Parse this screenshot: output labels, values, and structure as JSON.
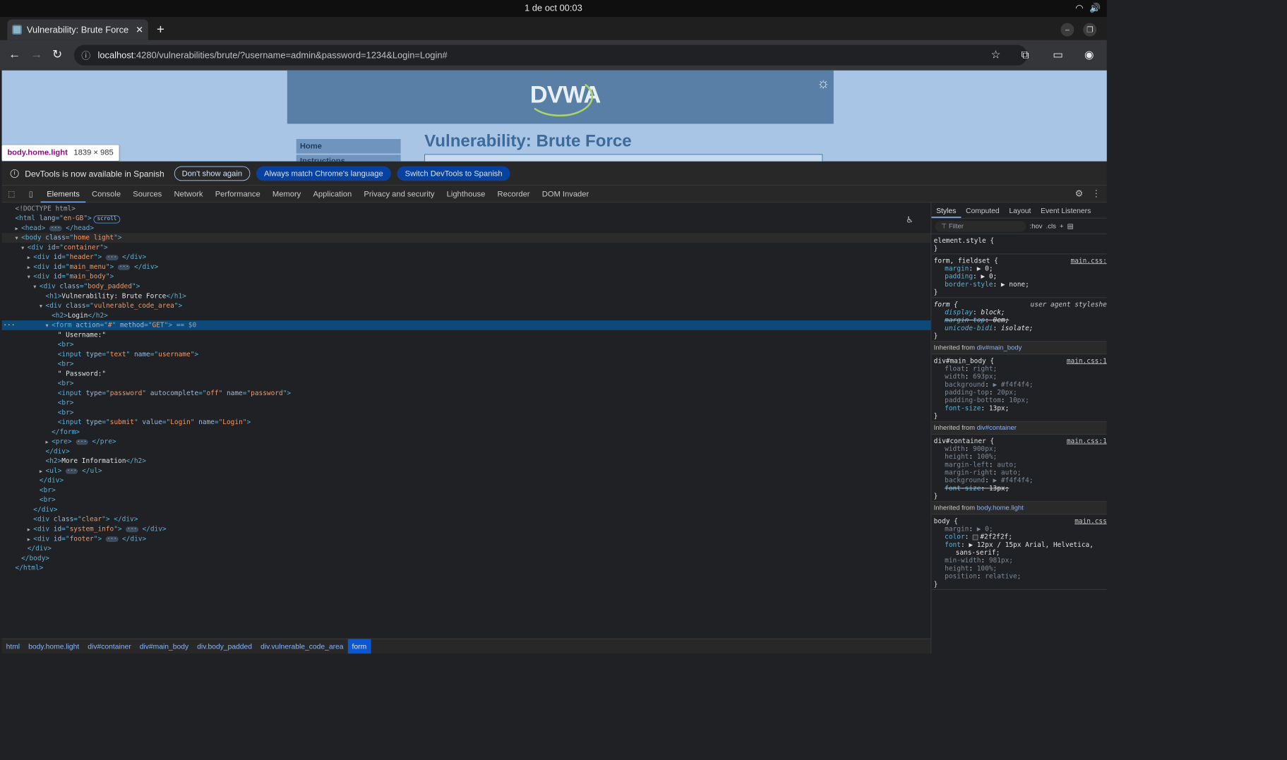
{
  "os_bar": {
    "datetime": "1 de oct  00:03"
  },
  "browser": {
    "tab_title": "Vulnerability: Brute Force",
    "url_host": "localhost",
    "url_rest": ":4280/vulnerabilities/brute/?username=admin&password=1234&Login=Login#"
  },
  "page": {
    "logo": "DVWA",
    "menu_item_1": "Home",
    "menu_item_2": "Instructions",
    "title": "Vulnerability: Brute Force"
  },
  "inspect_tooltip": {
    "selector": "body.home.light",
    "size": "1839 × 985"
  },
  "infobar": {
    "message": "DevTools is now available in Spanish",
    "btn_dont_show": "Don't show again",
    "btn_match": "Always match Chrome's language",
    "btn_switch": "Switch DevTools to Spanish"
  },
  "devtools_tabs": [
    "Elements",
    "Console",
    "Sources",
    "Network",
    "Performance",
    "Memory",
    "Application",
    "Privacy and security",
    "Lighthouse",
    "Recorder",
    "DOM Invader"
  ],
  "dom_lines": [
    {
      "indent": 0,
      "tri": "",
      "html": "<span class='cm'>&lt;!DOCTYPE html&gt;</span>"
    },
    {
      "indent": 0,
      "tri": "",
      "html": "<span class='t'>&lt;html </span><span class='an'>lang</span><span class='t'>=\"</span><span class='av'>en-GB</span><span class='t'>\"&gt;</span><span class='badge'>scroll</span>"
    },
    {
      "indent": 1,
      "tri": "▶",
      "html": "<span class='t'>&lt;head&gt;</span> <span class='ell'>···</span> <span class='t'>&lt;/head&gt;</span>"
    },
    {
      "indent": 1,
      "tri": "▼",
      "html": "<span class='t'>&lt;body </span><span class='an'>class</span><span class='t'>=\"</span><span class='av'>home light</span><span class='t'>\"&gt;</span>",
      "cls": "hov"
    },
    {
      "indent": 2,
      "tri": "▼",
      "html": "<span class='t'>&lt;div </span><span class='an'>id</span><span class='t'>=\"</span><span class='av'>container</span><span class='t'>\"&gt;</span>"
    },
    {
      "indent": 3,
      "tri": "▶",
      "html": "<span class='t'>&lt;div </span><span class='an'>id</span><span class='t'>=\"</span><span class='av'>header</span><span class='t'>\"&gt;</span> <span class='ell'>···</span> <span class='t'>&lt;/div&gt;</span>"
    },
    {
      "indent": 3,
      "tri": "▶",
      "html": "<span class='t'>&lt;div </span><span class='an'>id</span><span class='t'>=\"</span><span class='av'>main_menu</span><span class='t'>\"&gt;</span> <span class='ell'>···</span> <span class='t'>&lt;/div&gt;</span>"
    },
    {
      "indent": 3,
      "tri": "▼",
      "html": "<span class='t'>&lt;div </span><span class='an'>id</span><span class='t'>=\"</span><span class='av'>main_body</span><span class='t'>\"&gt;</span>"
    },
    {
      "indent": 4,
      "tri": "▼",
      "html": "<span class='t'>&lt;div </span><span class='an'>class</span><span class='t'>=\"</span><span class='av'>body_padded</span><span class='t'>\"&gt;</span>"
    },
    {
      "indent": 5,
      "tri": "",
      "html": "<span class='t'>&lt;h1&gt;</span><span class='tx'>Vulnerability: Brute Force</span><span class='t'>&lt;/h1&gt;</span>"
    },
    {
      "indent": 5,
      "tri": "▼",
      "html": "<span class='t'>&lt;div </span><span class='an'>class</span><span class='t'>=\"</span><span class='av'>vulnerable_code_area</span><span class='t'>\"&gt;</span>"
    },
    {
      "indent": 6,
      "tri": "",
      "html": "<span class='t'>&lt;h2&gt;</span><span class='tx'>Login</span><span class='t'>&lt;/h2&gt;</span>"
    },
    {
      "indent": 6,
      "tri": "▼",
      "html": "<span class='t'>&lt;form </span><span class='an'>action</span><span class='t'>=\"</span><span class='av'>#</span><span class='t'>\" </span><span class='an'>method</span><span class='t'>=\"</span><span class='av'>GET</span><span class='t'>\"&gt;</span> <span class='cm'>== $0</span>",
      "cls": "sel"
    },
    {
      "indent": 7,
      "tri": "",
      "html": "<span class='tx'>\" Username:\"</span>"
    },
    {
      "indent": 7,
      "tri": "",
      "html": "<span class='t'>&lt;br&gt;</span>"
    },
    {
      "indent": 7,
      "tri": "",
      "html": "<span class='t'>&lt;input </span><span class='an'>type</span><span class='t'>=\"</span><span class='av'>text</span><span class='t'>\" </span><span class='an'>name</span><span class='t'>=\"</span><span class='av'>username</span><span class='t'>\"&gt;</span>"
    },
    {
      "indent": 7,
      "tri": "",
      "html": "<span class='t'>&lt;br&gt;</span>"
    },
    {
      "indent": 7,
      "tri": "",
      "html": "<span class='tx'>\" Password:\"</span>"
    },
    {
      "indent": 7,
      "tri": "",
      "html": "<span class='t'>&lt;br&gt;</span>"
    },
    {
      "indent": 7,
      "tri": "",
      "html": "<span class='t'>&lt;input </span><span class='an'>type</span><span class='t'>=\"</span><span class='av'>password</span><span class='t'>\" </span><span class='an'>autocomplete</span><span class='t'>=\"</span><span class='av'>off</span><span class='t'>\" </span><span class='an'>name</span><span class='t'>=\"</span><span class='av'>password</span><span class='t'>\"&gt;</span>"
    },
    {
      "indent": 7,
      "tri": "",
      "html": "<span class='t'>&lt;br&gt;</span>"
    },
    {
      "indent": 7,
      "tri": "",
      "html": "<span class='t'>&lt;br&gt;</span>"
    },
    {
      "indent": 7,
      "tri": "",
      "html": "<span class='t'>&lt;input </span><span class='an'>type</span><span class='t'>=\"</span><span class='av'>submit</span><span class='t'>\" </span><span class='an'>value</span><span class='t'>=\"</span><span class='av'>Login</span><span class='t'>\" </span><span class='an'>name</span><span class='t'>=\"</span><span class='av'>Login</span><span class='t'>\"&gt;</span>"
    },
    {
      "indent": 6,
      "tri": "",
      "html": "<span class='t'>&lt;/form&gt;</span>"
    },
    {
      "indent": 6,
      "tri": "▶",
      "html": "<span class='t'>&lt;pre&gt;</span> <span class='ell'>···</span> <span class='t'>&lt;/pre&gt;</span>"
    },
    {
      "indent": 5,
      "tri": "",
      "html": "<span class='t'>&lt;/div&gt;</span>"
    },
    {
      "indent": 5,
      "tri": "",
      "html": "<span class='t'>&lt;h2&gt;</span><span class='tx'>More Information</span><span class='t'>&lt;/h2&gt;</span>"
    },
    {
      "indent": 5,
      "tri": "▶",
      "html": "<span class='t'>&lt;ul&gt;</span> <span class='ell'>···</span> <span class='t'>&lt;/ul&gt;</span>"
    },
    {
      "indent": 4,
      "tri": "",
      "html": "<span class='t'>&lt;/div&gt;</span>"
    },
    {
      "indent": 4,
      "tri": "",
      "html": "<span class='t'>&lt;br&gt;</span>"
    },
    {
      "indent": 4,
      "tri": "",
      "html": "<span class='t'>&lt;br&gt;</span>"
    },
    {
      "indent": 3,
      "tri": "",
      "html": "<span class='t'>&lt;/div&gt;</span>"
    },
    {
      "indent": 3,
      "tri": "",
      "html": "<span class='t'>&lt;div </span><span class='an'>class</span><span class='t'>=\"</span><span class='av'>clear</span><span class='t'>\"&gt; &lt;/div&gt;</span>"
    },
    {
      "indent": 3,
      "tri": "▶",
      "html": "<span class='t'>&lt;div </span><span class='an'>id</span><span class='t'>=\"</span><span class='av'>system_info</span><span class='t'>\"&gt;</span> <span class='ell'>···</span> <span class='t'>&lt;/div&gt;</span>"
    },
    {
      "indent": 3,
      "tri": "▶",
      "html": "<span class='t'>&lt;div </span><span class='an'>id</span><span class='t'>=\"</span><span class='av'>footer</span><span class='t'>\"&gt;</span> <span class='ell'>···</span> <span class='t'>&lt;/div&gt;</span>"
    },
    {
      "indent": 2,
      "tri": "",
      "html": "<span class='t'>&lt;/div&gt;</span>"
    },
    {
      "indent": 1,
      "tri": "",
      "html": "<span class='t'>&lt;/body&gt;</span>"
    },
    {
      "indent": 0,
      "tri": "",
      "html": "<span class='t'>&lt;/html&gt;</span>"
    }
  ],
  "breadcrumbs": [
    "html",
    "body.home.light",
    "div#container",
    "div#main_body",
    "div.body_padded",
    "div.vulnerable_code_area",
    "form"
  ],
  "styles_tabs": [
    "Styles",
    "Computed",
    "Layout",
    "Event Listeners"
  ],
  "styles_filter": {
    "placeholder": "Filter",
    "hov": ":hov",
    "cls": ".cls"
  },
  "styles": {
    "element_style": "element.style {",
    "r1_sel": "form, fieldset {",
    "r1_src": "main.css:",
    "r1_p1n": "margin",
    "r1_p1v": "▶ 0;",
    "r1_p2n": "padding",
    "r1_p2v": "▶ 0;",
    "r1_p3n": "border-style",
    "r1_p3v": "▶ none;",
    "r2_sel": "form {",
    "r2_src": "user agent styleshe",
    "r2_p1n": "display",
    "r2_p1v": "block;",
    "r2_p2n": "margin-top",
    "r2_p2v": "0em;",
    "r2_p3n": "unicode-bidi",
    "r2_p3v": "isolate;",
    "inh1": "Inherited from ",
    "inh1_sel": "div#main_body",
    "r3_sel": "div#main_body {",
    "r3_src": "main.css:1",
    "r3": [
      [
        "float",
        "right;"
      ],
      [
        "width",
        "693px;"
      ],
      [
        "background",
        "▶ #f4f4f4;"
      ],
      [
        "padding-top",
        "20px;"
      ],
      [
        "padding-bottom",
        "10px;"
      ]
    ],
    "r3_fsn": "font-size",
    "r3_fsv": "13px;",
    "inh2": "Inherited from ",
    "inh2_sel": "div#container",
    "r4_sel": "div#container {",
    "r4_src": "main.css:1",
    "r4": [
      [
        "width",
        "900px;"
      ],
      [
        "height",
        "100%;"
      ],
      [
        "margin-left",
        "auto;"
      ],
      [
        "margin-right",
        "auto;"
      ],
      [
        "background",
        "▶ #f4f4f4;"
      ]
    ],
    "r4_fsn": "font-size",
    "r4_fsv": "13px;",
    "inh3": "Inherited from ",
    "inh3_sel": "body.home.light",
    "r5_sel": "body {",
    "r5_src": "main.css",
    "r5_p1n": "margin",
    "r5_p1v": "▶ 0;",
    "r5_p2n": "color",
    "r5_p2v": "#2f2f2f;",
    "r5_p3n": "font",
    "r5_p3v": "▶ 12px / 15px Arial, Helvetica,",
    "r5_p3cont": "sans-serif;",
    "r5_dim": [
      [
        "min-width",
        "981px;"
      ],
      [
        "height",
        "100%;"
      ],
      [
        "position",
        "relative;"
      ]
    ],
    "close": "}"
  }
}
